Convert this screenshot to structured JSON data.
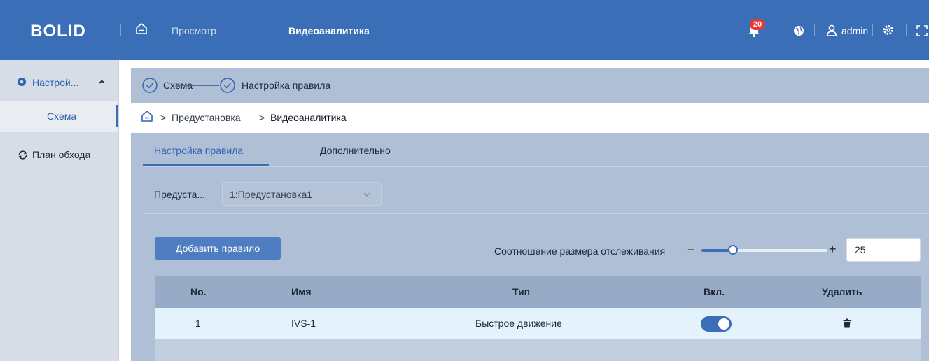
{
  "header": {
    "logo": "BOLID",
    "nav": [
      {
        "label": "Просмотр",
        "active": false
      },
      {
        "label": "Видеоаналитика",
        "active": true
      }
    ],
    "notifications_count": "20",
    "user": "admin",
    "accent_color": "#3a6fb8"
  },
  "sidebar": {
    "group_label": "Настрой...",
    "group_icon": "settings-icon",
    "active_item": "Схема",
    "item2_label": "План обхода",
    "item2_icon": "tour-icon"
  },
  "steps": [
    {
      "label": "Схема",
      "done": true
    },
    {
      "label": "Настройка правила",
      "done": true
    }
  ],
  "breadcrumb": {
    "parts": [
      "Предустановка",
      "Видеоаналитика"
    ],
    "separator": ">"
  },
  "tabs": [
    {
      "label": "Настройка правила",
      "active": true
    },
    {
      "label": "Дополнительно",
      "active": false
    }
  ],
  "preset": {
    "label": "Предуста...",
    "selected": "1:Предустановка1"
  },
  "toolbar": {
    "add_rule_label": "Добавить правило",
    "ratio_label": "Соотношение размера отслеживания",
    "minus": "−",
    "plus": "+",
    "ratio_value": "25",
    "ratio_min": 0,
    "ratio_max": 100
  },
  "table": {
    "headers": [
      "No.",
      "Имя",
      "Тип",
      "Вкл.",
      "Удалить"
    ],
    "rows": [
      {
        "no": "1",
        "name": "IVS-1",
        "type": "Быстрое движение",
        "enabled": true
      }
    ]
  }
}
